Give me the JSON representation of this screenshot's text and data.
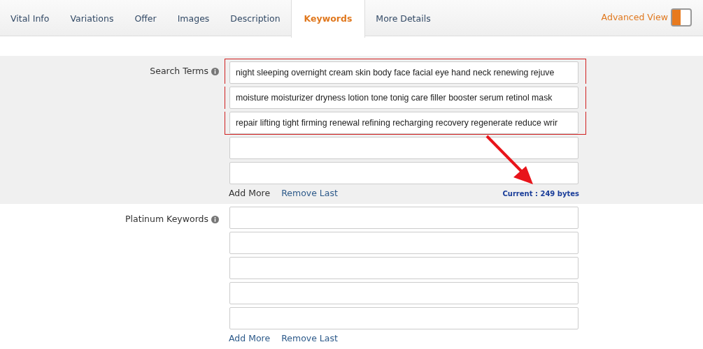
{
  "tabs": [
    {
      "label": "Vital Info",
      "selected": false
    },
    {
      "label": "Variations",
      "selected": false
    },
    {
      "label": "Offer",
      "selected": false
    },
    {
      "label": "Images",
      "selected": false
    },
    {
      "label": "Description",
      "selected": false
    },
    {
      "label": "Keywords",
      "selected": true
    },
    {
      "label": "More Details",
      "selected": false
    }
  ],
  "advanced_view": {
    "label": "Advanced View",
    "on": true
  },
  "sections": [
    {
      "label": "Search Terms",
      "shaded": true,
      "fields": [
        {
          "value": "night sleeping overnight cream skin body face facial eye hand neck renewing rejuve",
          "highlighted": true
        },
        {
          "value": "moisture moisturizer dryness lotion tone tonig care filler booster serum retinol mask",
          "highlighted": true
        },
        {
          "value": "repair lifting tight firming renewal refining recharging recovery regenerate reduce wrir",
          "highlighted": true
        },
        {
          "highlighted": false
        },
        {
          "highlighted": false
        }
      ],
      "add_more": {
        "label": "Add More",
        "disabled": true
      },
      "remove_last": "Remove Last",
      "counter": "Current : 249 bytes"
    },
    {
      "label": "Platinum Keywords",
      "shaded": false,
      "fields": [
        {
          "highlighted": false
        },
        {
          "highlighted": false
        },
        {
          "highlighted": false
        },
        {
          "highlighted": false
        },
        {
          "highlighted": false
        }
      ],
      "add_more": {
        "label": "Add More",
        "disabled": false
      },
      "remove_last": "Remove Last"
    }
  ]
}
